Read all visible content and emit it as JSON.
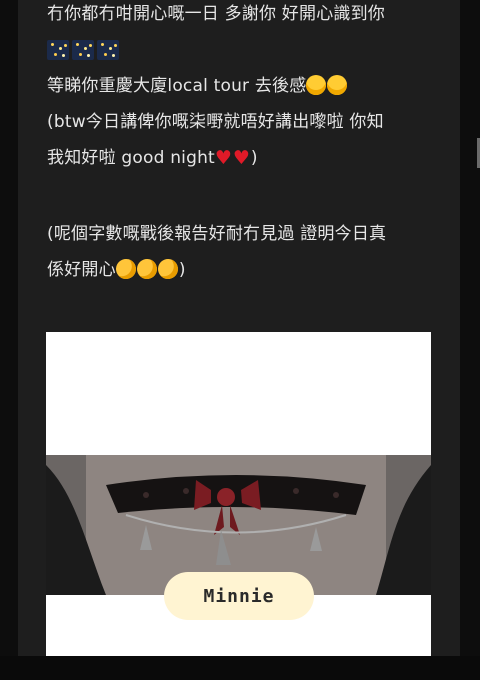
{
  "post": {
    "line1": "冇你都冇咁開心嘅一日 多謝你 好開心識到你",
    "line3": "等睇你重慶大廈local tour 去後感",
    "line4": "(btw今日講俾你嘅柒嘢就唔好講出嚟啦 你知",
    "line5_text": "我知好啦 good night",
    "line5_end": ")",
    "line7": "(呢個字數嘅戰後報告好耐冇見過 證明今日真",
    "line8_text": "係好開心",
    "line8_end": ")"
  },
  "photo": {
    "caption": "Minnie"
  }
}
